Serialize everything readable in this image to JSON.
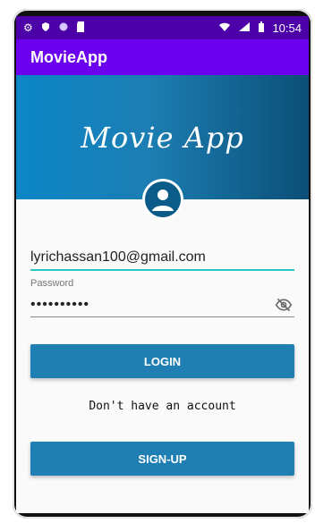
{
  "status_bar": {
    "time": "10:54",
    "left_icons": [
      "settings-icon",
      "shield-icon",
      "circle-icon",
      "sd-card-icon"
    ],
    "right_icons": [
      "wifi-icon",
      "signal-icon",
      "battery-icon"
    ]
  },
  "app_bar": {
    "title": "MovieApp"
  },
  "banner": {
    "title": "Movie App"
  },
  "form": {
    "email": {
      "value": "lyrichassan100@gmail.com"
    },
    "password": {
      "label": "Password",
      "value": "••••••••••"
    },
    "login_label": "LOGIN",
    "no_account_text": "Don't have an account",
    "signup_label": "SIGN-UP"
  },
  "colors": {
    "status_bar_bg": "#4b00a8",
    "app_bar_bg": "#6b00ee",
    "button_bg": "#1f7fb3",
    "email_underline": "#2ec6c0"
  }
}
